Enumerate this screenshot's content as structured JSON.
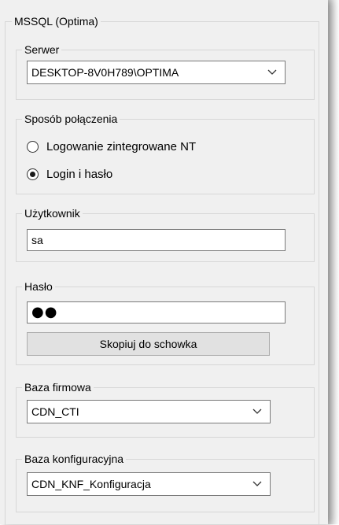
{
  "group_main": {
    "label": "MSSQL (Optima)"
  },
  "serwer": {
    "label": "Serwer",
    "value": "DESKTOP-8V0H789\\OPTIMA",
    "icon": "chevron-down-icon"
  },
  "connection": {
    "label": "Sposób połączenia",
    "options": [
      {
        "label": "Logowanie zintegrowane NT",
        "selected": false
      },
      {
        "label": "Login i hasło",
        "selected": true
      }
    ]
  },
  "user": {
    "label": "Użytkownik",
    "value": "sa"
  },
  "password": {
    "label": "Hasło",
    "value_masked": "●●",
    "copy_button": "Skopiuj do schowka"
  },
  "company_db": {
    "label": "Baza firmowa",
    "value": "CDN_CTI",
    "icon": "chevron-down-icon"
  },
  "config_db": {
    "label": "Baza konfiguracyjna",
    "value": "CDN_KNF_Konfiguracja",
    "icon": "chevron-down-icon"
  },
  "colors": {
    "window_bg": "#f0f0f0",
    "groupbox_border": "#d7d7d7",
    "control_border": "#7a7a7a",
    "button_bg": "#e1e1e1"
  }
}
